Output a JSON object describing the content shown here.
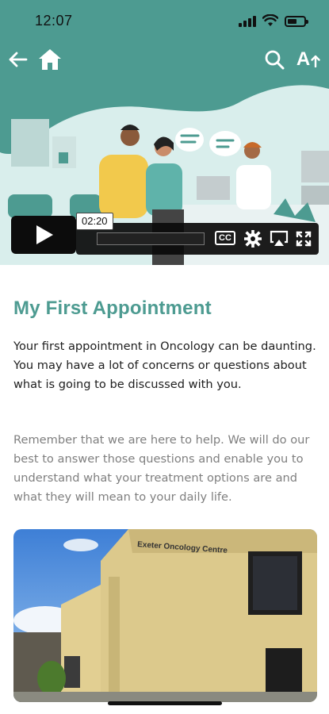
{
  "status_bar": {
    "time": "12:07"
  },
  "header": {
    "back_icon": "arrow-left-icon",
    "home_icon": "home-icon",
    "search_icon": "search-icon",
    "text_size_icon": "text-size-icon",
    "text_size_label": "A"
  },
  "video": {
    "timestamp": "02:20",
    "controls": [
      "play-icon",
      "closed-captions-icon",
      "gear-icon",
      "airplay-icon",
      "fullscreen-icon"
    ],
    "cc_label": "CC"
  },
  "article": {
    "title": "My First Appointment",
    "paragraph1": "Your first appointment in Oncology can be daunting. You may have a lot of concerns or questions about what is going to be discussed with you.",
    "paragraph2": "Remember that we are here to help. We will do our best to answer those questions and enable you to understand what your treatment options are and what they will mean to your daily life."
  },
  "photo": {
    "sign_text": "Exeter Oncology Centre"
  },
  "colors": {
    "brand": "#4d9b91",
    "muted_text": "#7f7f7f"
  }
}
